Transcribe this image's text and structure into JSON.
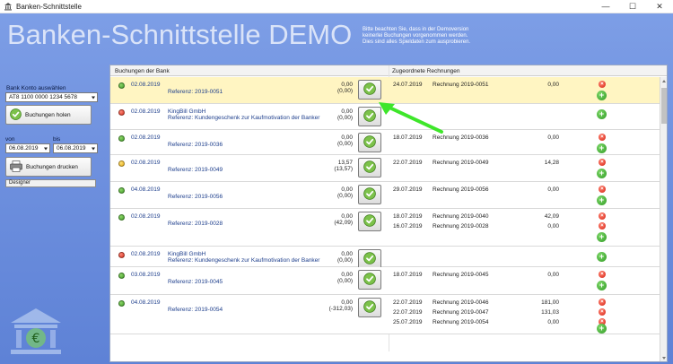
{
  "window": {
    "title": "Banken-Schnittstelle",
    "minimize": "—",
    "maximize": "☐",
    "close": "✕"
  },
  "banner": "Banken-Schnittstelle DEMO",
  "notice": [
    "Bitte beachten Sie, dass in der Demoversion",
    "keinerlei Buchungen vorgenommen werden.",
    "Dies sind alles Spieldaten zum ausprobieren."
  ],
  "left": {
    "account_label": "Bank Konto auswählen",
    "account_value": "AT8 1100 0000 1234 5678",
    "fetch_button": "Buchungen holen",
    "from_label": "von",
    "to_label": "bis",
    "from_value": "06.08.2019",
    "to_value": "06.08.2019",
    "print_button": "Buchungen drucken",
    "designer_label": "Designer"
  },
  "table": {
    "header_left": "Buchungen der Bank",
    "header_right": "Zugeordnete Rechnungen",
    "rows": [
      {
        "status": "green",
        "date": "02.08.2019",
        "line1": "",
        "line2": "Referenz: 2019-0051",
        "amount": "0,00",
        "amount2": "(0,00)",
        "selected": true,
        "invoices": [
          {
            "date": "24.07.2019",
            "name": "Rechnung 2019-0051",
            "amount": "0,00"
          }
        ]
      },
      {
        "status": "red",
        "date": "02.08.2019",
        "line1": "KingBill GmbH",
        "line2": "Referenz: Kundengeschenk zur Kaufmotivation der Banker",
        "amount": "0,00",
        "amount2": "(0,00)",
        "selected": false,
        "invoices": []
      },
      {
        "status": "green",
        "date": "02.08.2019",
        "line1": "",
        "line2": "Referenz: 2019-0036",
        "amount": "0,00",
        "amount2": "(0,00)",
        "selected": false,
        "invoices": [
          {
            "date": "18.07.2019",
            "name": "Rechnung 2019-0036",
            "amount": "0,00"
          }
        ]
      },
      {
        "status": "yellow",
        "date": "02.08.2019",
        "line1": "",
        "line2": "Referenz: 2019-0049",
        "amount": "13,57",
        "amount2": "(13,57)",
        "selected": false,
        "invoices": [
          {
            "date": "22.07.2019",
            "name": "Rechnung 2019-0049",
            "amount": "14,28"
          }
        ]
      },
      {
        "status": "green",
        "date": "04.08.2019",
        "line1": "",
        "line2": "Referenz: 2019-0056",
        "amount": "0,00",
        "amount2": "(0,00)",
        "selected": false,
        "invoices": [
          {
            "date": "29.07.2019",
            "name": "Rechnung 2019-0056",
            "amount": "0,00"
          }
        ]
      },
      {
        "status": "green",
        "date": "02.08.2019",
        "line1": "",
        "line2": "Referenz: 2019-0028",
        "amount": "0,00",
        "amount2": "(42,09)",
        "selected": false,
        "invoices": [
          {
            "date": "18.07.2019",
            "name": "Rechnung 2019-0040",
            "amount": "42,09"
          },
          {
            "date": "16.07.2019",
            "name": "Rechnung 2019-0028",
            "amount": "0,00"
          }
        ]
      },
      {
        "status": "red",
        "date": "02.08.2019",
        "line1": "KingBill GmbH",
        "line2": "Referenz: Kundengeschenk zur Kaufmotivation der Banker",
        "amount": "0,00",
        "amount2": "(0,00)",
        "selected": false,
        "invoices": []
      },
      {
        "status": "green",
        "date": "03.08.2019",
        "line1": "",
        "line2": "Referenz: 2019-0045",
        "amount": "0,00",
        "amount2": "(0,00)",
        "selected": false,
        "invoices": [
          {
            "date": "18.07.2019",
            "name": "Rechnung 2019-0045",
            "amount": "0,00"
          }
        ]
      },
      {
        "status": "green",
        "date": "04.08.2019",
        "line1": "",
        "line2": "Referenz: 2019-0054",
        "amount": "0,00",
        "amount2": "(-312,03)",
        "selected": false,
        "invoices": [
          {
            "date": "22.07.2019",
            "name": "Rechnung 2019-0046",
            "amount": "181,00"
          },
          {
            "date": "22.07.2019",
            "name": "Rechnung 2019-0047",
            "amount": "131,03"
          },
          {
            "date": "25.07.2019",
            "name": "Rechnung 2019-0054",
            "amount": "0,00"
          }
        ]
      }
    ]
  },
  "colors": {
    "background": "#6f91df",
    "selected_row": "#fff5c2",
    "annotation_arrow": "#3ee62a"
  },
  "icons": {
    "check": "check-icon",
    "delete": "delete-icon",
    "add": "add-icon",
    "printer": "printer-icon",
    "bank": "bank-euro-icon"
  }
}
